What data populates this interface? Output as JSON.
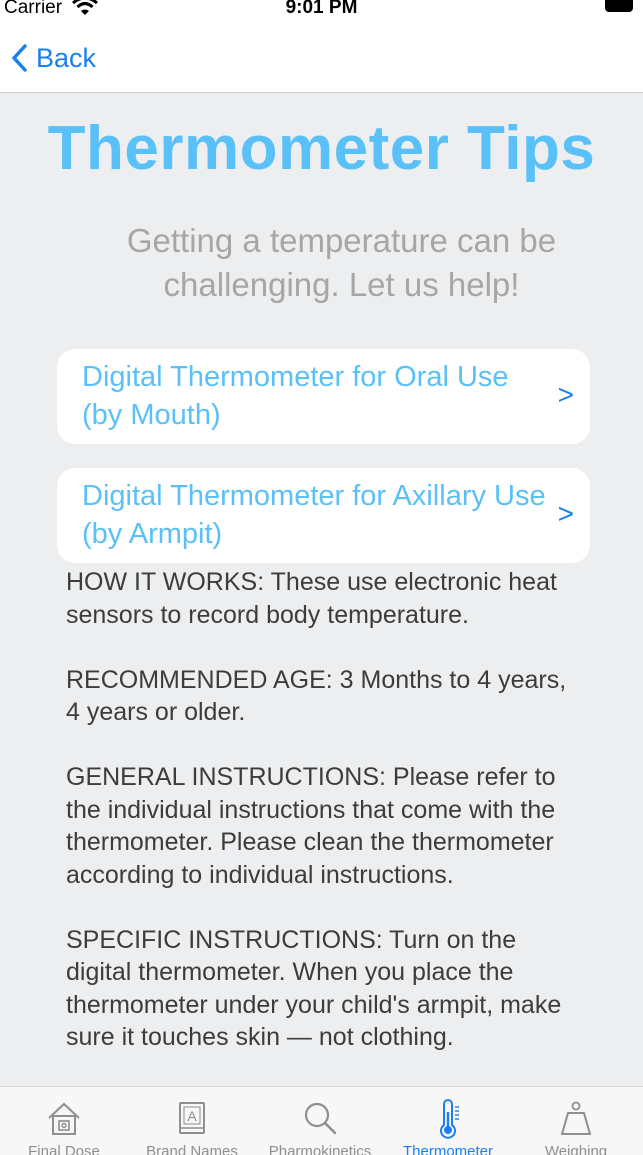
{
  "status_bar": {
    "carrier": "Carrier",
    "time": "9:01 PM"
  },
  "nav": {
    "back_label": "Back"
  },
  "page": {
    "title": "Thermometer Tips",
    "subtitle": "Getting a temperature can be challenging.  Let us help!"
  },
  "links": [
    {
      "label": "Digital Thermometer for Oral Use (by Mouth)",
      "chevron": ">"
    },
    {
      "label": "Digital Thermometer for Axillary Use (by Armpit)",
      "chevron": ">"
    }
  ],
  "info": {
    "how_it_works": "HOW IT WORKS:  These use electronic heat sensors to record body temperature.",
    "recommended_age": "RECOMMENDED AGE: 3 Months to 4 years, 4 years or older.",
    "general_instructions": "GENERAL INSTRUCTIONS: Please refer to the individual instructions that come with the thermometer.  Please clean the thermometer according to individual instructions.",
    "specific_instructions": "SPECIFIC INSTRUCTIONS: Turn on the digital thermometer. When you place the thermometer under your child's armpit, make sure it touches skin — not clothing."
  },
  "tabs": [
    {
      "label": "Final Dose",
      "icon": "house-icon",
      "active": false
    },
    {
      "label": "Brand Names",
      "icon": "book-icon",
      "active": false
    },
    {
      "label": "Pharmokinetics",
      "icon": "magnifier-icon",
      "active": false
    },
    {
      "label": "Thermometer",
      "icon": "thermometer-icon",
      "active": true
    },
    {
      "label": "Weighing",
      "icon": "scale-icon",
      "active": false
    }
  ],
  "colors": {
    "accent": "#1a7ff0",
    "title": "#5ac0f8",
    "background": "#eceef0"
  }
}
